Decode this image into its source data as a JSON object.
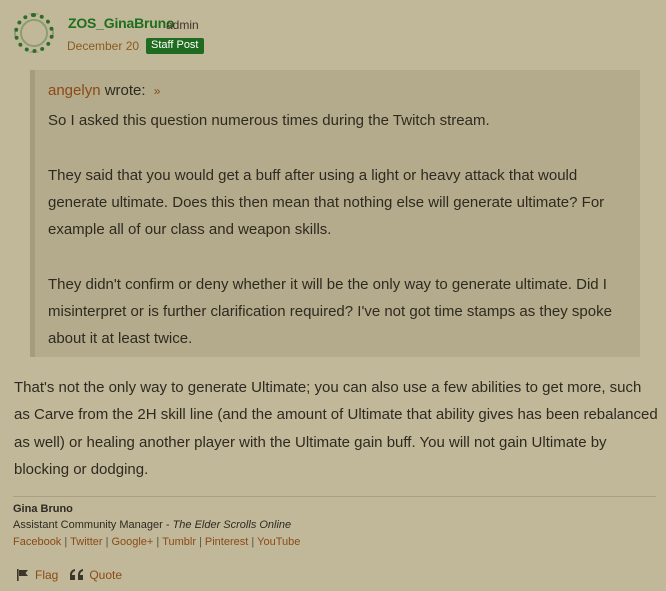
{
  "post": {
    "username": "ZOS_GinaBruno",
    "role": "admin",
    "date": "December 20",
    "badge": "Staff Post"
  },
  "quote": {
    "author": "angelyn",
    "wrote": "wrote:",
    "arrow": "»",
    "paragraphs": [
      "So I asked this question numerous times during the Twitch stream.",
      "They said that you would get a buff after using a light or heavy attack that would generate ultimate. Does this then mean that nothing else will generate ultimate? For example all of our class and weapon skills.",
      "They didn't confirm or deny whether it will be the only way to generate ultimate. Did I misinterpret or is further clarification required? I've not got time stamps as they spoke about it at least twice."
    ]
  },
  "reply": {
    "text": "That's not the only way to generate Ultimate; you can also use a few abilities to get more, such as Carve from the 2H skill line (and the amount of Ultimate that ability gives has been rebalanced as well) or healing another player with the Ultimate gain buff. You will not gain Ultimate by blocking or dodging."
  },
  "signature": {
    "name": "Gina Bruno",
    "title": "Assistant Community Manager - ",
    "game": "The Elder Scrolls Online",
    "links": [
      "Facebook",
      "Twitter",
      "Google+",
      "Tumblr",
      "Pinterest",
      "YouTube"
    ],
    "separator": "|"
  },
  "actions": {
    "flag": "Flag",
    "quote": "Quote"
  },
  "colors": {
    "background": "#c1b89a",
    "username": "#1f6e1c",
    "badge": "#1f6b1f",
    "link": "#8b4a16",
    "quote_bg": "#b4ab8c"
  }
}
